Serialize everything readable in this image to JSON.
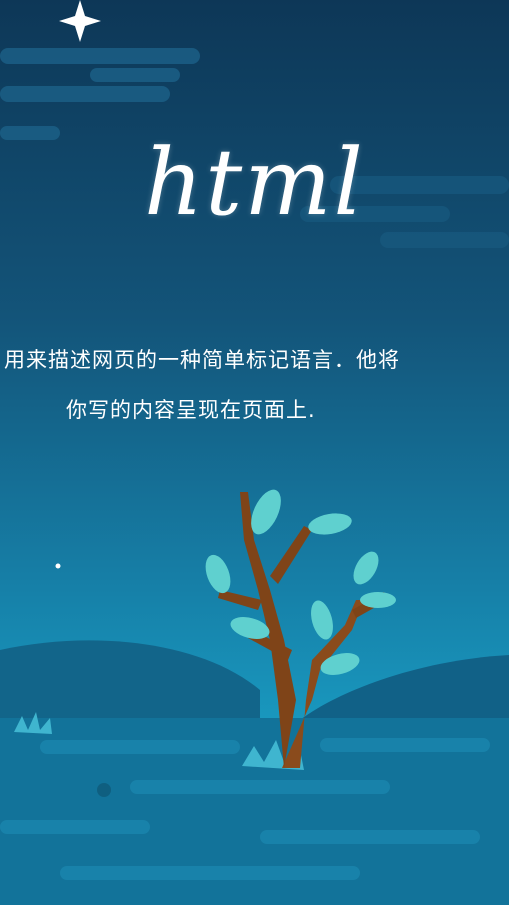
{
  "poster": {
    "title": "html",
    "description_line1": "用来描述网页的一种简单标记语言．他将",
    "description_line2": "你写的内容呈现在页面上."
  },
  "colors": {
    "sky_top": "#0d3b5c",
    "sky_bottom": "#1a9cc0",
    "ground": "#136e93",
    "trunk": "#8a4b1c",
    "leaf": "#5fd0cf",
    "star": "#ffffff"
  },
  "icons": [
    "star-icon",
    "tree-icon",
    "grass-icon",
    "cloud-icon"
  ]
}
